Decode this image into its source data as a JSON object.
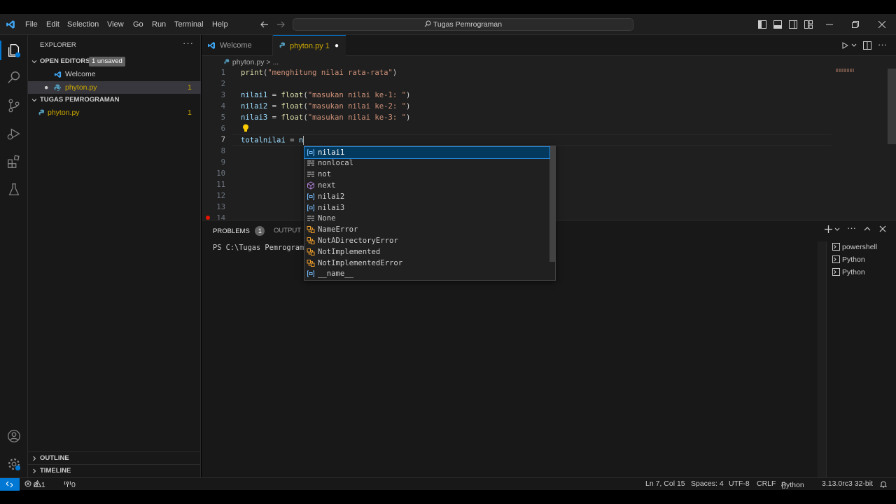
{
  "app": {
    "menu": [
      "File",
      "Edit",
      "Selection",
      "View",
      "Go",
      "Run",
      "Terminal",
      "Help"
    ],
    "search_title": "Tugas Pemrograman"
  },
  "explorer": {
    "title": "EXPLORER",
    "open_editors": {
      "label": "OPEN EDITORS",
      "badge": "1 unsaved",
      "items": [
        {
          "name": "Welcome",
          "problems": ""
        },
        {
          "name": "phyton.py",
          "problems": "1"
        }
      ]
    },
    "folder": {
      "label": "TUGAS PEMROGRAMAN",
      "items": [
        {
          "name": "phyton.py",
          "problems": "1"
        }
      ]
    },
    "outline": "OUTLINE",
    "timeline": "TIMELINE"
  },
  "tabs": [
    {
      "label": "Welcome",
      "active": false
    },
    {
      "label": "phyton.py 1",
      "active": true,
      "dirty": true
    }
  ],
  "breadcrumb": {
    "file": "phyton.py",
    "sep": ">",
    "rest": "..."
  },
  "editor": {
    "line_numbers": [
      "1",
      "2",
      "3",
      "4",
      "5",
      "6",
      "7",
      "8",
      "9",
      "10",
      "11",
      "12",
      "13",
      "14"
    ],
    "lines": [
      {
        "fn": "print",
        "open": "(",
        "str": "\"menghitung nilai rata-rata\"",
        "close": ")"
      },
      {},
      {
        "var": "nilai1",
        "eq": " = ",
        "fn": "float",
        "open": "(",
        "str": "\"masukan nilai ke-1: \"",
        "close": ")"
      },
      {
        "var": "nilai2",
        "eq": " = ",
        "fn": "float",
        "open": "(",
        "str": "\"masukan nilai ke-2: \"",
        "close": ")"
      },
      {
        "var": "nilai3",
        "eq": " = ",
        "fn": "float",
        "open": "(",
        "str": "\"masukan nilai ke-3: \"",
        "close": ")"
      },
      {},
      {
        "var": "totalnilai",
        "eq": " = ",
        "typed": "n"
      }
    ],
    "current_line": 7
  },
  "suggest": {
    "items": [
      {
        "label": "nilai1",
        "kind": "variable",
        "selected": true
      },
      {
        "label": "nonlocal",
        "kind": "keyword"
      },
      {
        "label": "not",
        "kind": "keyword"
      },
      {
        "label": "next",
        "kind": "method"
      },
      {
        "label": "nilai2",
        "kind": "variable"
      },
      {
        "label": "nilai3",
        "kind": "variable"
      },
      {
        "label": "None",
        "kind": "keyword"
      },
      {
        "label": "NameError",
        "kind": "class"
      },
      {
        "label": "NotADirectoryError",
        "kind": "class"
      },
      {
        "label": "NotImplemented",
        "kind": "class"
      },
      {
        "label": "NotImplementedError",
        "kind": "class"
      },
      {
        "label": "__name__",
        "kind": "variable"
      }
    ]
  },
  "panel": {
    "tabs": [
      {
        "label": "PROBLEMS",
        "badge": "1"
      },
      {
        "label": "OUTPUT"
      }
    ],
    "terminal_text": "PS C:\\Tugas Pemrograma",
    "terminals": [
      "powershell",
      "Python",
      "Python"
    ]
  },
  "status": {
    "errors": "0",
    "warnings": "1",
    "ports": "0",
    "position": "Ln 7, Col 15",
    "spaces": "Spaces: 4",
    "encoding": "UTF-8",
    "eol": "CRLF",
    "language": "Python",
    "interpreter": "3.13.0rc3 32-bit"
  },
  "colors": {
    "accent": "#0078d4",
    "selection": "#04395e",
    "match": "#2aaaff"
  }
}
